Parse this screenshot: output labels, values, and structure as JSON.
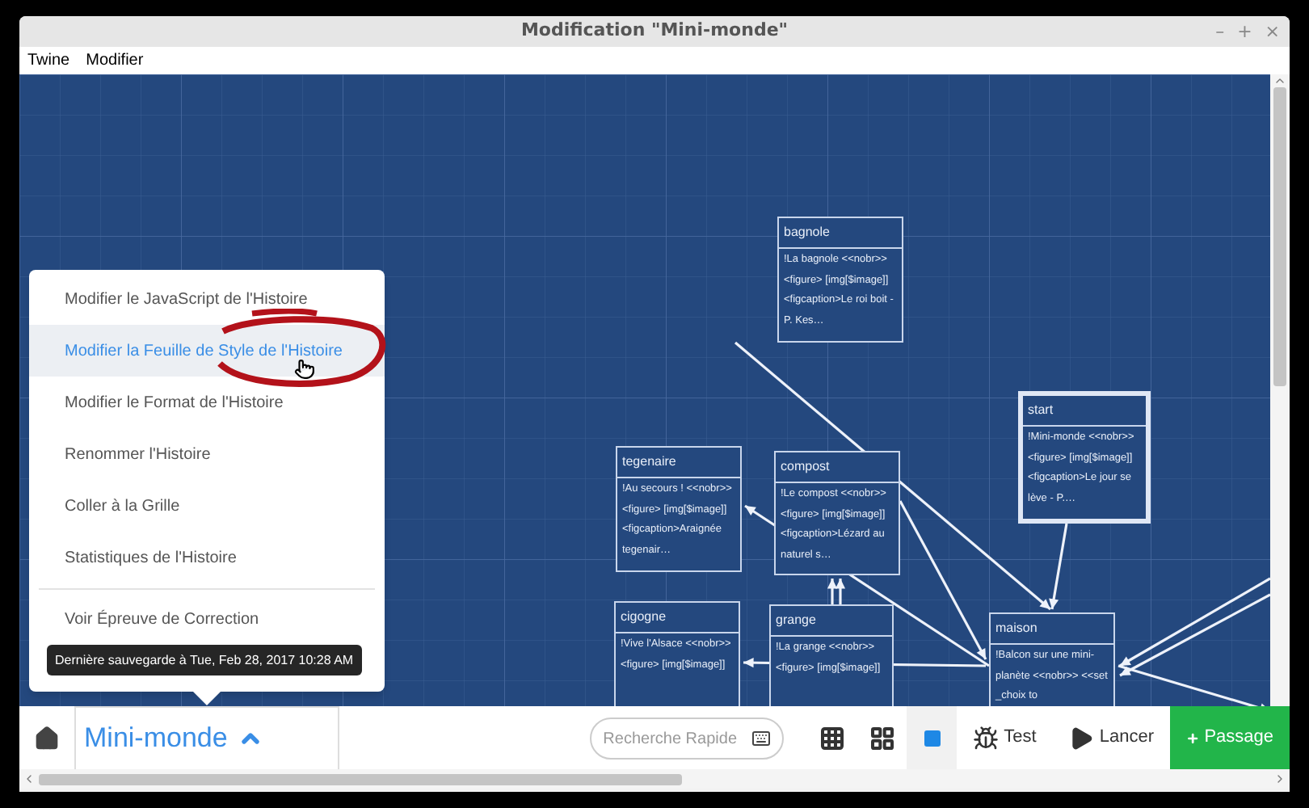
{
  "window": {
    "title": "Modification \"Mini-monde\"",
    "controls": [
      "–",
      "+",
      "×"
    ]
  },
  "menu_bar": [
    "Twine",
    "Modifier"
  ],
  "passages": [
    {
      "name": "bagnole",
      "excerpt": "!La bagnole <<nobr>> <figure> [img[$image]] <figcaption>Le roi boit - P. Kes…",
      "selected": false
    },
    {
      "name": "start",
      "excerpt": "!Mini-monde <<nobr>><figure> [img[$image]] <figcaption>Le jour se lève - P.…",
      "selected": true
    },
    {
      "name": "tegenaire",
      "excerpt": "!Au secours ! <<nobr>> <figure> [img[$image]] <figcaption>Araignée tegenair…",
      "selected": false
    },
    {
      "name": "compost",
      "excerpt": "!Le compost <<nobr>> <figure> [img[$image]] <figcaption>Lézard au naturel s…",
      "selected": false
    },
    {
      "name": "cigogne",
      "excerpt": "!Vive l'Alsace <<nobr>><figure> [img[$image]]",
      "selected": false
    },
    {
      "name": "grange",
      "excerpt": "!La grange <<nobr>> <figure> [img[$image]]",
      "selected": false
    },
    {
      "name": "maison",
      "excerpt": "!Balcon sur une mini-planète <<nobr>> <<set _choix to",
      "selected": false
    }
  ],
  "story_menu": {
    "items": [
      {
        "label": "Modifier le JavaScript de l'Histoire",
        "selected": false
      },
      {
        "label": "Modifier la Feuille de Style de l'Histoire",
        "selected": true
      },
      {
        "label": "Modifier le Format de l'Histoire",
        "selected": false
      },
      {
        "label": "Renommer l'Histoire",
        "selected": false
      },
      {
        "label": "Coller à la Grille",
        "selected": false
      },
      {
        "label": "Statistiques de l'Histoire",
        "selected": false
      }
    ],
    "footer_item": "Voir Épreuve de Correction"
  },
  "tooltip": "Dernière sauvegarde à Tue, Feb 28, 2017 10:28 AM",
  "toolbar": {
    "story_title": "Mini-monde",
    "search": {
      "placeholder": "Recherche Rapide"
    },
    "zoom_levels": [
      {
        "selected": false
      },
      {
        "selected": false
      },
      {
        "selected": true
      }
    ],
    "buttons": [
      {
        "label": "Test",
        "kind": "test"
      },
      {
        "label": "Lancer",
        "kind": "play"
      },
      {
        "label": "Passage",
        "kind": "add"
      }
    ]
  }
}
